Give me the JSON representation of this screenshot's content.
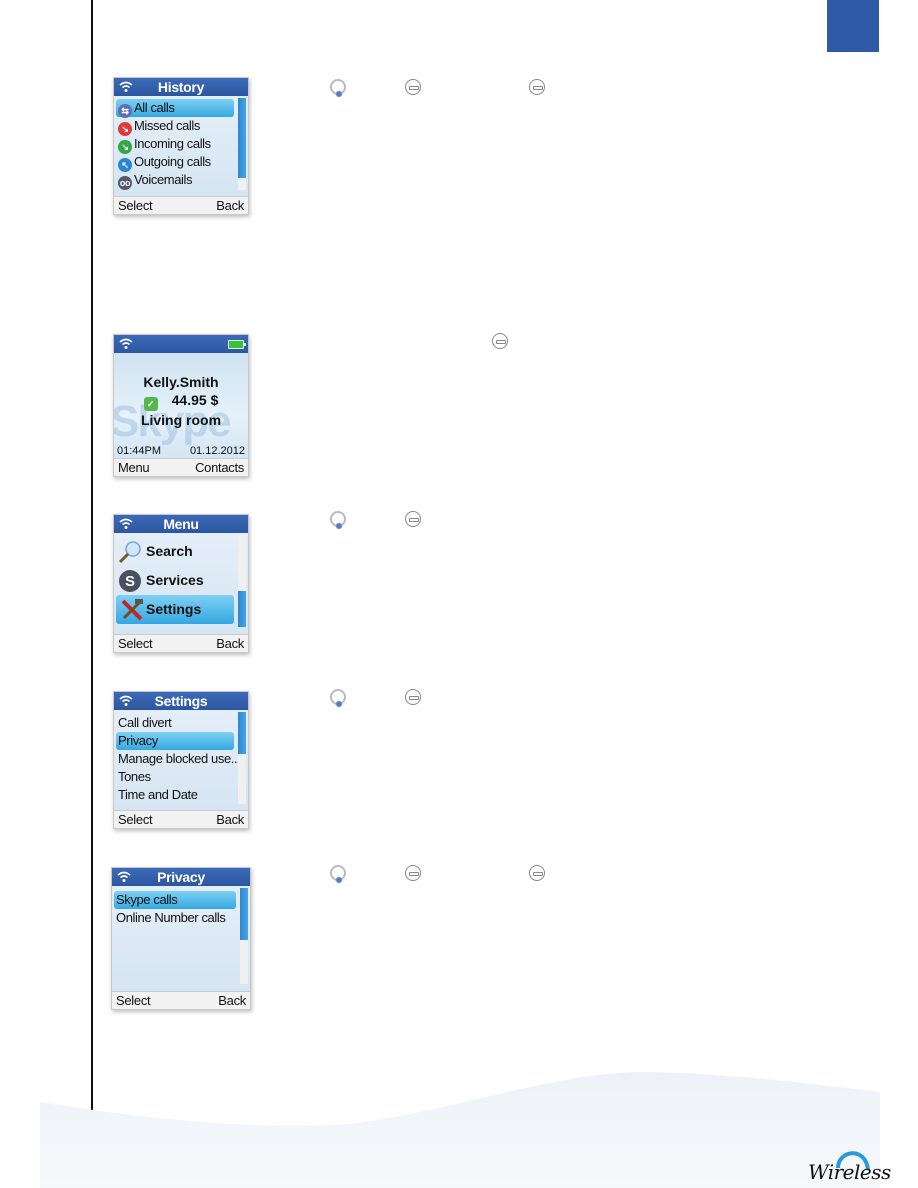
{
  "page": {
    "brand_logo_text": "Wireless",
    "accent_color": "#2e5aa6"
  },
  "screens": {
    "history": {
      "title": "History",
      "items": [
        {
          "label": "All calls",
          "icon": "all-calls-icon",
          "selected": true
        },
        {
          "label": "Missed calls",
          "icon": "missed-calls-icon"
        },
        {
          "label": "Incoming calls",
          "icon": "incoming-calls-icon"
        },
        {
          "label": "Outgoing calls",
          "icon": "outgoing-calls-icon"
        },
        {
          "label": "Voicemails",
          "icon": "voicemail-icon"
        }
      ],
      "left_softkey": "Select",
      "right_softkey": "Back"
    },
    "idle": {
      "username": "Kelly.Smith",
      "credit": "44.95 $",
      "location": "Living room",
      "watermark": "Skype",
      "time": "01:44PM",
      "date": "01.12.2012",
      "left_softkey": "Menu",
      "right_softkey": "Contacts"
    },
    "menu": {
      "title": "Menu",
      "items": [
        {
          "label": "Search",
          "icon": "search-icon"
        },
        {
          "label": "Services",
          "icon": "skype-services-icon"
        },
        {
          "label": "Settings",
          "icon": "settings-tools-icon",
          "selected": true
        }
      ],
      "left_softkey": "Select",
      "right_softkey": "Back"
    },
    "settings": {
      "title": "Settings",
      "items": [
        {
          "label": "Call divert"
        },
        {
          "label": "Privacy",
          "selected": true
        },
        {
          "label": "Manage blocked use..."
        },
        {
          "label": "Tones"
        },
        {
          "label": "Time and Date"
        }
      ],
      "left_softkey": "Select",
      "right_softkey": "Back"
    },
    "privacy": {
      "title": "Privacy",
      "items": [
        {
          "label": "Skype calls",
          "selected": true
        },
        {
          "label": "Online Number calls"
        }
      ],
      "left_softkey": "Select",
      "right_softkey": "Back"
    }
  },
  "key_rows": [
    [
      "nav-key-icon",
      "soft-key-icon",
      "soft-key-icon"
    ],
    [
      "soft-key-icon"
    ],
    [
      "nav-key-icon",
      "soft-key-icon"
    ],
    [
      "nav-key-icon",
      "soft-key-icon"
    ],
    [
      "nav-key-icon",
      "soft-key-icon",
      "soft-key-icon"
    ]
  ]
}
